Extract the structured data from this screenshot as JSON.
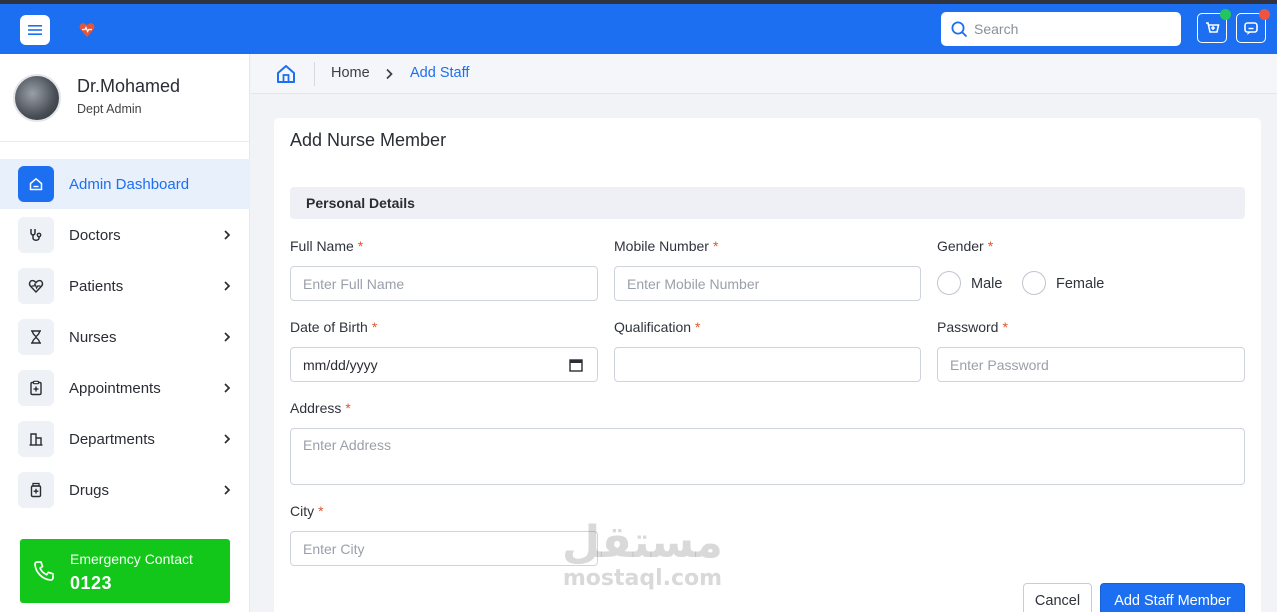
{
  "header": {
    "search_placeholder": "Search",
    "notification_dot_color": "#22c55e",
    "message_dot_color": "#f0543c"
  },
  "profile": {
    "name": "Dr.Mohamed",
    "role": "Dept Admin"
  },
  "sidebar": {
    "items": [
      {
        "label": "Admin Dashboard",
        "icon": "home-icon",
        "active": true
      },
      {
        "label": "Doctors",
        "icon": "stethoscope-icon"
      },
      {
        "label": "Patients",
        "icon": "heart-pulse-icon"
      },
      {
        "label": "Nurses",
        "icon": "hourglass-icon"
      },
      {
        "label": "Appointments",
        "icon": "clipboard-plus-icon"
      },
      {
        "label": "Departments",
        "icon": "building-icon"
      },
      {
        "label": "Drugs",
        "icon": "medicine-bottle-icon"
      }
    ],
    "emergency": {
      "label": "Emergency Contact",
      "number": "0123"
    }
  },
  "breadcrumb": {
    "home": "Home",
    "current": "Add Staff"
  },
  "form": {
    "title": "Add Nurse Member",
    "section": "Personal Details",
    "required_mark": "*",
    "full_name": {
      "label": "Full Name",
      "placeholder": "Enter Full Name"
    },
    "mobile": {
      "label": "Mobile Number",
      "placeholder": "Enter Mobile Number"
    },
    "gender": {
      "label": "Gender",
      "options": [
        "Male",
        "Female"
      ]
    },
    "dob": {
      "label": "Date of Birth",
      "value": "mm/dd/yyyy"
    },
    "qualification": {
      "label": "Qualification",
      "placeholder": ""
    },
    "password": {
      "label": "Password",
      "placeholder": "Enter Password"
    },
    "address": {
      "label": "Address",
      "placeholder": "Enter Address"
    },
    "city": {
      "label": "City",
      "placeholder": "Enter City"
    },
    "cancel_label": "Cancel",
    "submit_label": "Add Staff Member"
  },
  "watermark": {
    "arabic": "مستقل",
    "latin": "mostaql.com"
  }
}
